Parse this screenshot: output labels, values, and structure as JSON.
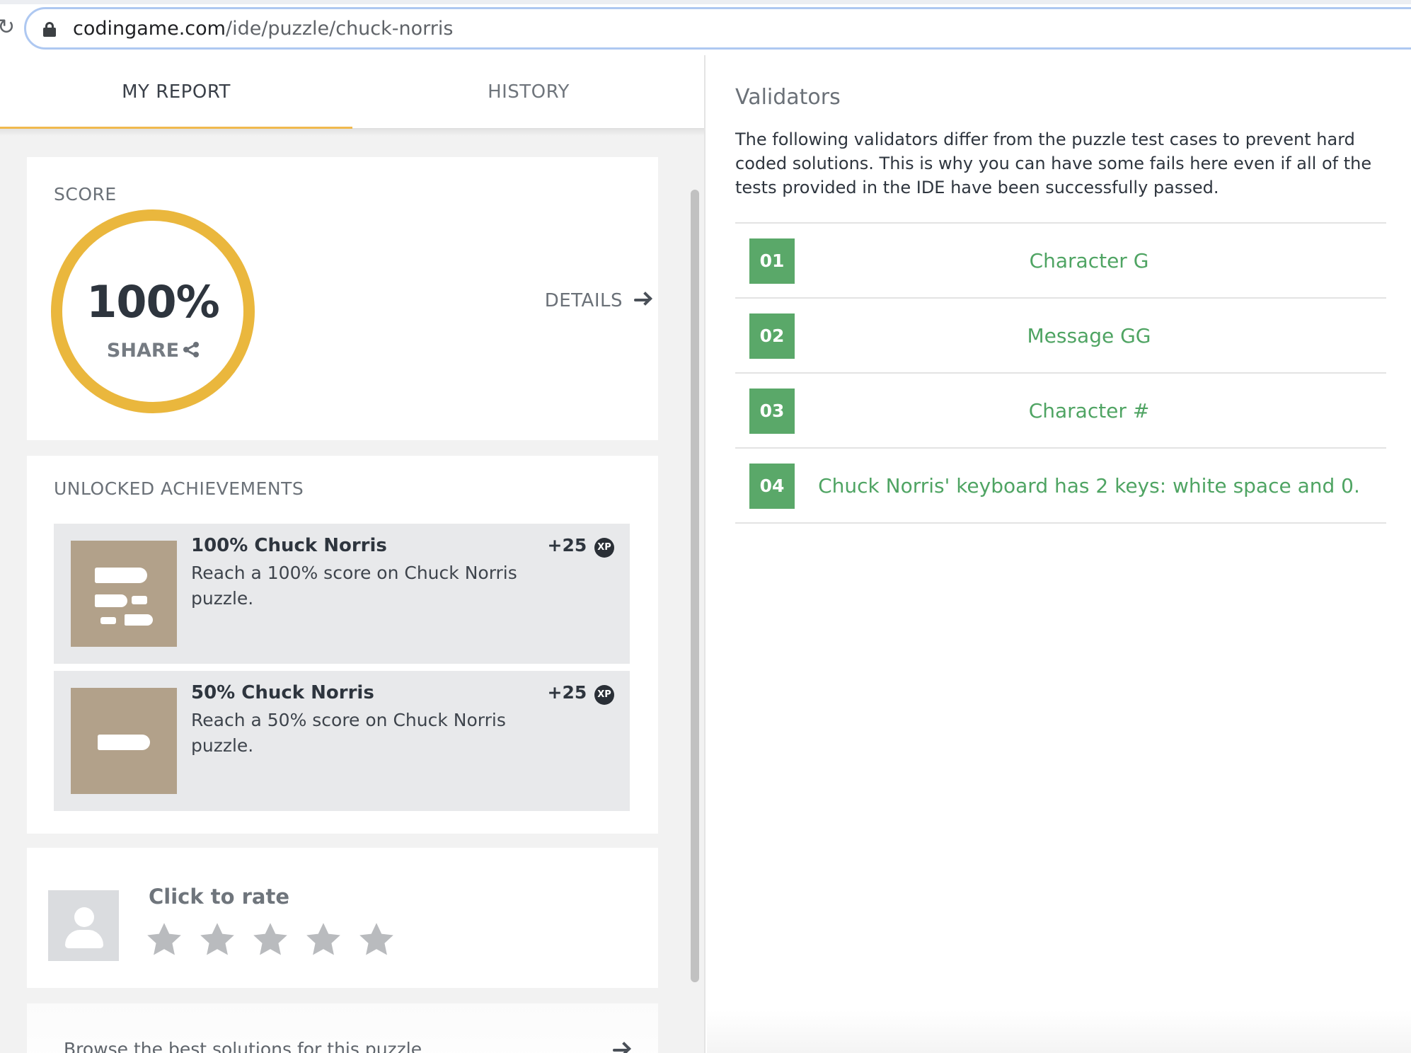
{
  "browser": {
    "url_host": "codingame.com",
    "url_path": "/ide/puzzle/chuck-norris"
  },
  "tabs": [
    {
      "label": "MY REPORT",
      "active": true
    },
    {
      "label": "HISTORY",
      "active": false
    }
  ],
  "score": {
    "label": "SCORE",
    "value": "100%",
    "share_label": "SHARE",
    "details_label": "DETAILS",
    "ring_color": "#eab73d"
  },
  "achievements": {
    "label": "UNLOCKED ACHIEVEMENTS",
    "items": [
      {
        "title": "100% Chuck Norris",
        "description": "Reach a 100% score on Chuck Norris puzzle.",
        "xp": "+25",
        "xp_badge": "XP",
        "icon": "bullets-icon"
      },
      {
        "title": "50% Chuck Norris",
        "description": "Reach a 50% score on Chuck Norris puzzle.",
        "xp": "+25",
        "xp_badge": "XP",
        "icon": "bullet-icon"
      }
    ]
  },
  "rating": {
    "title": "Click to rate",
    "stars": 5
  },
  "browse": {
    "label": "Browse the best solutions for this puzzle"
  },
  "validators": {
    "title": "Validators",
    "description": "The following validators differ from the puzzle test cases to prevent hard coded solutions. This is why you can have some fails here even if all of the tests provided in the IDE have been successfully passed.",
    "items": [
      {
        "number": "01",
        "name": "Character G"
      },
      {
        "number": "02",
        "name": "Message GG"
      },
      {
        "number": "03",
        "name": "Character #"
      },
      {
        "number": "04",
        "name": "Chuck Norris' keyboard has 2 keys: white space and 0."
      }
    ],
    "accent_color": "#5aa869"
  }
}
